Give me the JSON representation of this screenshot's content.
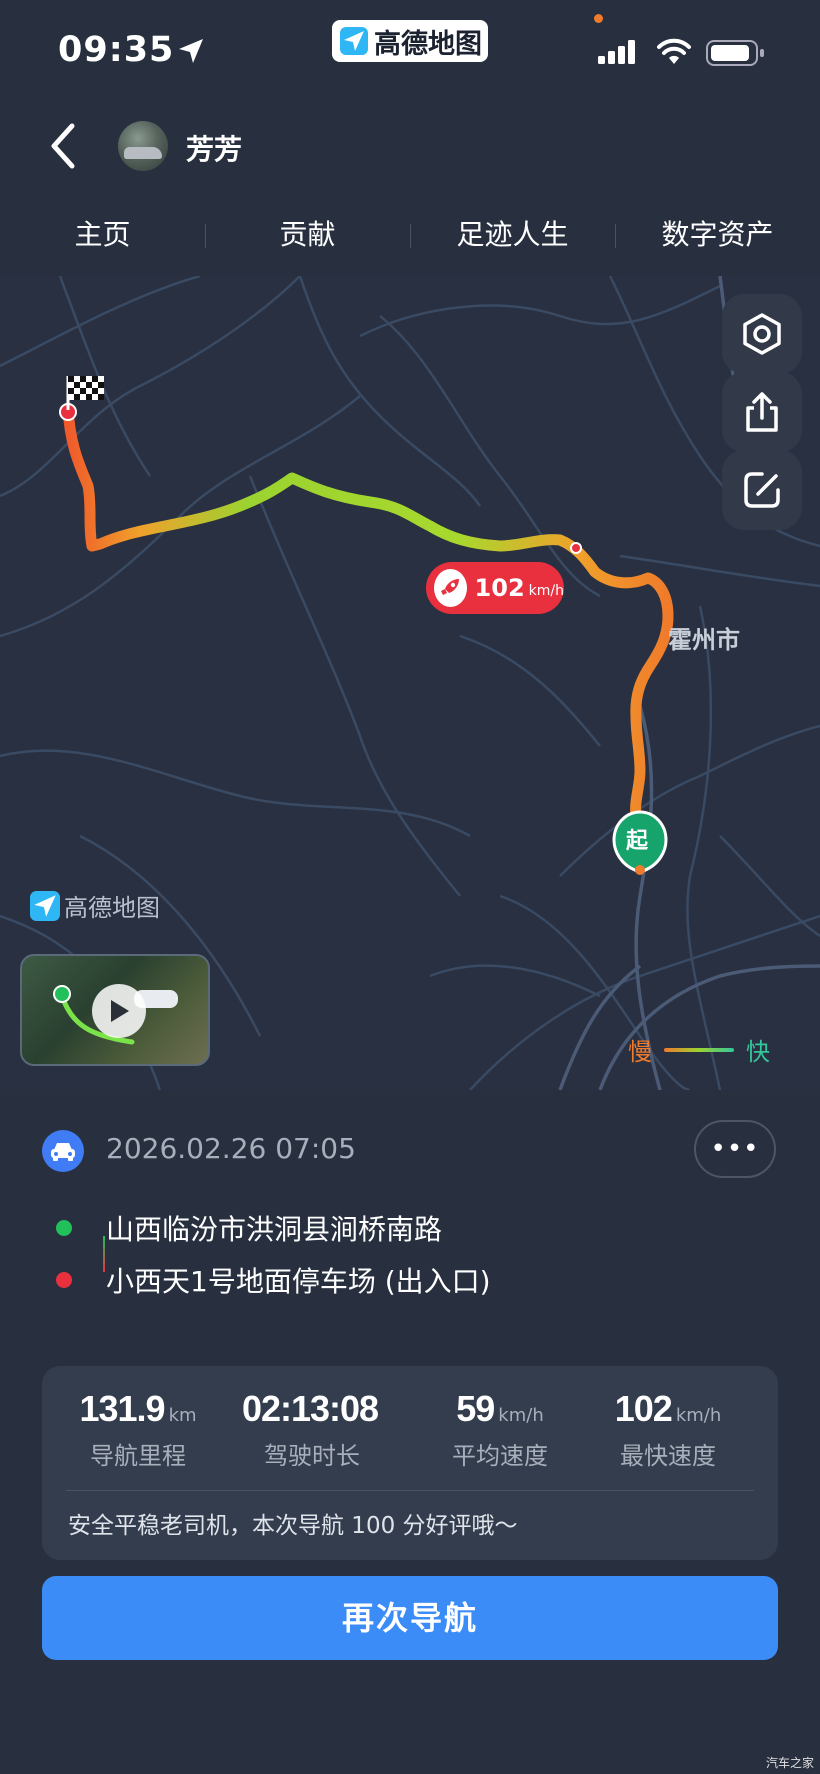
{
  "status_bar": {
    "time": "09:35",
    "app_badge": "高德地图"
  },
  "header": {
    "username": "芳芳"
  },
  "tabs": [
    {
      "label": "主页"
    },
    {
      "label": "贡献"
    },
    {
      "label": "足迹人生"
    },
    {
      "label": "数字资产"
    }
  ],
  "map": {
    "max_speed_value": "102",
    "max_speed_unit": "km/h",
    "city_label": "霍州市",
    "start_marker": "起",
    "logo_text": "高德地图",
    "legend": {
      "slow": "慢",
      "fast": "快"
    },
    "colors": {
      "slow": "#f07b2b",
      "mid": "#9bd330",
      "fast": "#35c59a",
      "bubble": "#e8303f"
    }
  },
  "trip": {
    "datetime": "2026.02.26 07:05",
    "more_label": "•••",
    "start_address": "山西临汾市洪洞县涧桥南路",
    "end_address": "小西天1号地面停车场 (出入口)",
    "stats": [
      {
        "value": "131.9",
        "unit": "km",
        "label": "导航里程"
      },
      {
        "value": "02:13:08",
        "unit": "",
        "label": "驾驶时长"
      },
      {
        "value": "59",
        "unit": "km/h",
        "label": "平均速度"
      },
      {
        "value": "102",
        "unit": "km/h",
        "label": "最快速度"
      }
    ],
    "comment": "安全平稳老司机，本次导航 100 分好评哦～",
    "renavigate_label": "再次导航"
  },
  "watermark": "汽车之家"
}
